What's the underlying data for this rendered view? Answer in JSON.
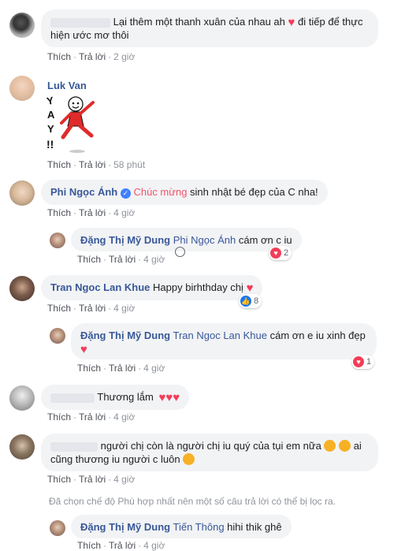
{
  "actions": {
    "like": "Thích",
    "reply": "Trả lời"
  },
  "comments": [
    {
      "author": "",
      "text": "Lại thêm một thanh xuân của nhau ah",
      "text2": "đi tiếp để thực hiện ước mơ thôi",
      "time": "2 giờ"
    },
    {
      "author": "Luk Van",
      "sticker_text": "YAY!!",
      "time": "58 phút"
    },
    {
      "author": "Phi Ngọc Ánh",
      "tag": "Chúc mừng",
      "text": "sinh nhật bé đẹp của C nha!",
      "time": "4 giờ",
      "reply": {
        "author": "Đặng Thị Mỹ Dung",
        "tag": "Phi Ngọc Ánh",
        "text": "cám ơn c iu",
        "time": "4 giờ",
        "reaction_count": "2"
      }
    },
    {
      "author": "Tran Ngoc Lan Khue",
      "text": "Happy birhthday chị",
      "time": "4 giờ",
      "reaction_count": "8",
      "reply": {
        "author": "Đặng Thị Mỹ Dung",
        "tag": "Tran Ngoc Lan Khue",
        "text": "cám ơn e iu xinh đẹp",
        "time": "4 giờ",
        "reaction_count": "1"
      }
    },
    {
      "author": "",
      "text": "Thương lắm",
      "time": "4 giờ"
    },
    {
      "author": "",
      "text": "người chị còn là người chị iu quý của tụi em nữa",
      "text2": "ai",
      "text3": "cũng thương iu người c luôn",
      "time": "4 giờ"
    }
  ],
  "filter_note": "Đã chọn chế độ Phù hợp nhất nên một số câu trả lời có thể bị lọc ra.",
  "last_reply": {
    "author": "Đặng Thị Mỹ Dung",
    "tag": "Tiến Thông",
    "text": "hihi thik ghê",
    "time": "4 giờ"
  },
  "colors": {
    "name": "#385898",
    "bubble": "#f2f3f5",
    "heart": "#f33e58",
    "like": "#1877f2"
  }
}
